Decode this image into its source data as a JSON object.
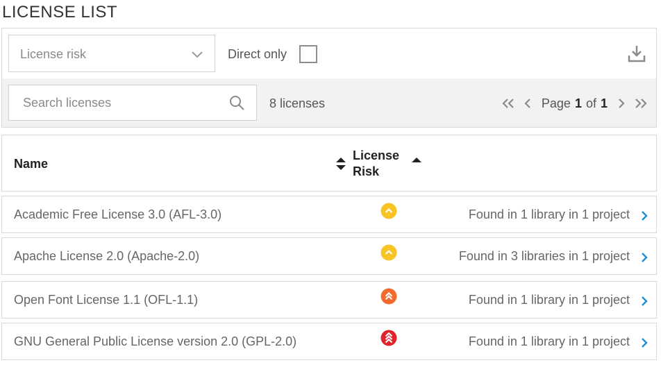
{
  "page": {
    "title": "LICENSE LIST"
  },
  "filters": {
    "risk_placeholder": "License risk",
    "direct_only_label": "Direct only",
    "direct_only_checked": false,
    "download_icon": "download-icon"
  },
  "search": {
    "placeholder": "Search licenses",
    "value": "",
    "count_label": "8 licenses"
  },
  "pagination": {
    "page_label": "Page",
    "current": "1",
    "of_label": "of",
    "total": "1"
  },
  "table": {
    "columns": {
      "name": "Name",
      "risk": "License Risk"
    },
    "rows": [
      {
        "name": "Academic Free License 3.0 (AFL-3.0)",
        "risk": "low",
        "risk_color": "#f7c325",
        "found": "Found in 1 library in 1 project"
      },
      {
        "name": "Apache License 2.0 (Apache-2.0)",
        "risk": "low",
        "risk_color": "#f7c325",
        "found": "Found in 3 libraries in 1 project"
      },
      {
        "name": "Open Font License 1.1 (OFL-1.1)",
        "risk": "medium",
        "risk_color": "#f26a30",
        "found": "Found in 1 library in 1 project"
      },
      {
        "name": "GNU General Public License version 2.0 (GPL-2.0)",
        "risk": "high",
        "risk_color": "#e0222a",
        "found": "Found in 1 library in 1 project"
      }
    ]
  },
  "colors": {
    "accent": "#1a8fd6",
    "low_risk": "#f7c325",
    "medium_risk": "#f26a30",
    "high_risk": "#e0222a"
  }
}
